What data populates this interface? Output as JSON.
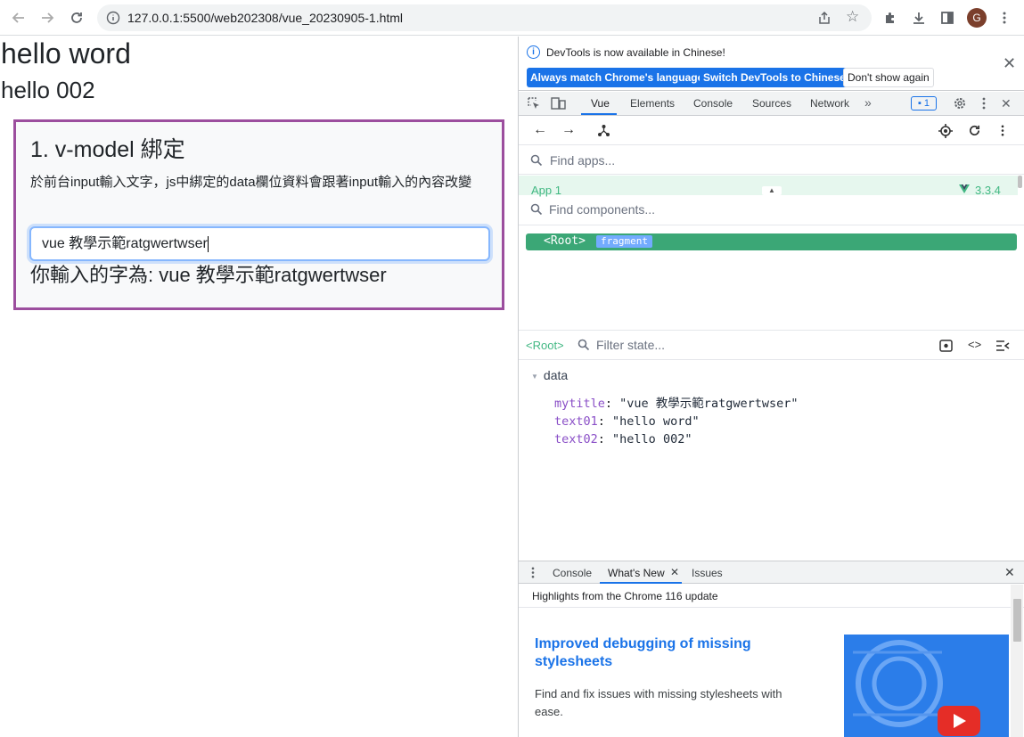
{
  "browser": {
    "url": "127.0.0.1:5500/web202308/vue_20230905-1.html",
    "avatar_letter": "G"
  },
  "page": {
    "text01": "hello word",
    "text02": "hello 002",
    "card": {
      "title": "1. v-model 綁定",
      "description": "於前台input輸入文字，js中綁定的data欄位資料會跟著input輸入的內容改變",
      "input_value": "vue 教學示範ratgwertwser",
      "output": "你輸入的字為: vue 教學示範ratgwertwser"
    }
  },
  "devtools": {
    "infobar": {
      "message": "DevTools is now available in Chinese!",
      "btn_match": "Always match Chrome's language",
      "btn_switch": "Switch DevTools to Chinese",
      "btn_dismiss": "Don't show again"
    },
    "tabs": [
      "Vue",
      "Elements",
      "Console",
      "Sources",
      "Network"
    ],
    "issues_count": "1",
    "vue": {
      "find_apps_placeholder": "Find apps...",
      "app_name": "App 1",
      "vue_version": "3.3.4",
      "find_components_placeholder": "Find components...",
      "root_tag": "<Root>",
      "root_badge": "fragment",
      "state_root": "<Root>",
      "filter_state_placeholder": "Filter state...",
      "section": "data",
      "state": [
        {
          "key": "mytitle",
          "value": "\"vue 教學示範ratgwertwser\""
        },
        {
          "key": "text01",
          "value": "\"hello word\""
        },
        {
          "key": "text02",
          "value": "\"hello 002\""
        }
      ]
    },
    "drawer": {
      "tabs": [
        "Console",
        "What's New",
        "Issues"
      ],
      "header": "Highlights from the Chrome 116 update",
      "news_title": "Improved debugging of missing stylesheets",
      "news_desc": "Find and fix issues with missing stylesheets with ease."
    }
  }
}
